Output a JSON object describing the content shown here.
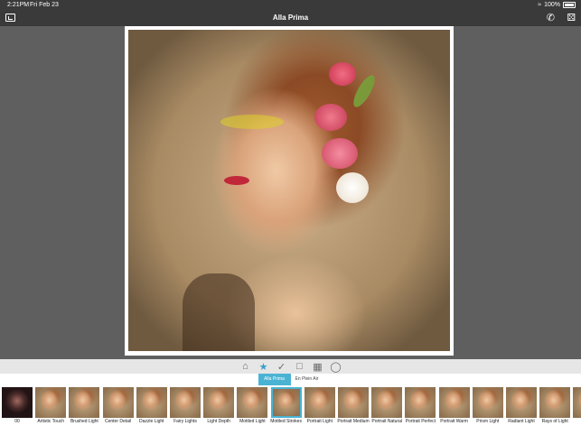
{
  "status": {
    "time": "2:21PM",
    "date": "Fri Feb 23",
    "battery": "100%"
  },
  "nav": {
    "title": "Alla Prima",
    "left_icon": "image-icon",
    "right_icons": [
      "phone-icon",
      "dice-icon"
    ]
  },
  "toolbar": {
    "icons": [
      "home-icon",
      "star-icon",
      "brush-icon",
      "frame-icon",
      "texture-icon",
      "lasso-icon"
    ],
    "active": "star-icon",
    "accent": "#3aa0c8"
  },
  "tabs": [
    {
      "label": "Alla Prima",
      "active": true
    },
    {
      "label": "En Plein Air",
      "active": false
    }
  ],
  "filters": [
    {
      "label": "00",
      "dark": true
    },
    {
      "label": "Artistic Touch"
    },
    {
      "label": "Brushed Light"
    },
    {
      "label": "Center Detail"
    },
    {
      "label": "Dazzle Light"
    },
    {
      "label": "Fairy Lights"
    },
    {
      "label": "Light Depth"
    },
    {
      "label": "Mottled Light"
    },
    {
      "label": "Mottled Strokes",
      "selected": true
    },
    {
      "label": "Portrait Light"
    },
    {
      "label": "Portrait Medium"
    },
    {
      "label": "Portrait Natural"
    },
    {
      "label": "Portrait Perfect"
    },
    {
      "label": "Portrait Warm"
    },
    {
      "label": "Prism Light"
    },
    {
      "label": "Radiant Light"
    },
    {
      "label": "Rays of Light"
    },
    {
      "label": "R"
    }
  ]
}
